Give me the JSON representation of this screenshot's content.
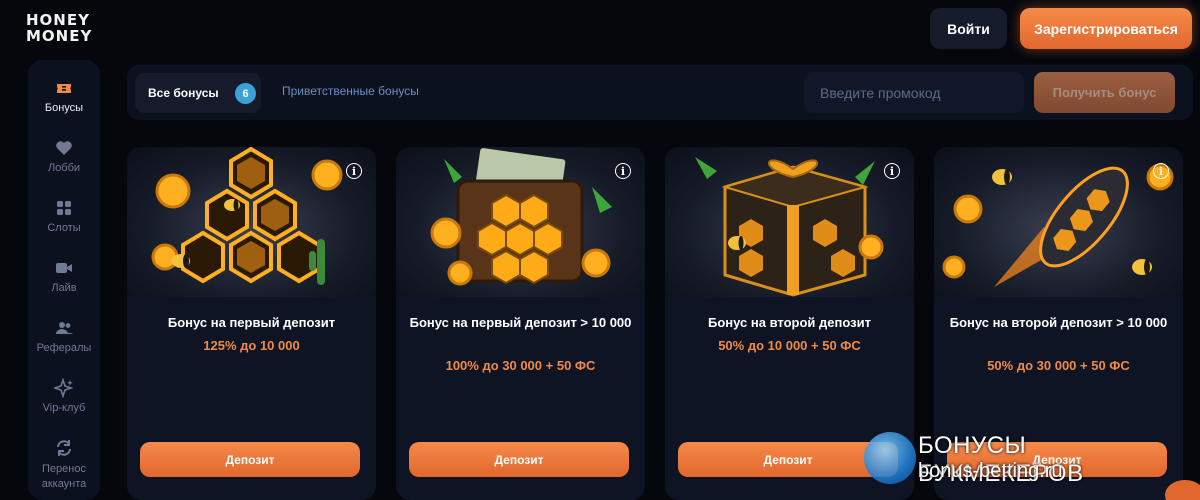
{
  "header": {
    "logo_line1": "HONEY",
    "logo_line2": "MONEY",
    "login_label": "Войти",
    "register_label": "Зарегистрироваться"
  },
  "sidebar": {
    "items": [
      {
        "label": "Бонусы",
        "icon": "ticket-icon",
        "active": true
      },
      {
        "label": "Лобби",
        "icon": "heart-icon",
        "active": false
      },
      {
        "label": "Слоты",
        "icon": "grid-icon",
        "active": false
      },
      {
        "label": "Лайв",
        "icon": "video-camera-icon",
        "active": false
      },
      {
        "label": "Рефералы",
        "icon": "users-icon",
        "active": false
      },
      {
        "label": "Vip-клуб",
        "icon": "sparkle-icon",
        "active": false
      },
      {
        "label": "Перенос аккаунта",
        "icon": "transfer-icon",
        "active": false
      }
    ]
  },
  "filters": {
    "tab_all_label": "Все бонусы",
    "tab_all_count": "6",
    "tab_welcome_label": "Приветственные бонусы",
    "promo_placeholder": "Введите промокод",
    "promo_button_label": "Получить бонус"
  },
  "cards": [
    {
      "title": "Бонус на первый депозит",
      "value": "125% до 10 000",
      "button": "Депозит",
      "art": "honeycomb"
    },
    {
      "title": "Бонус на первый депозит > 10 000",
      "value": "100% до 30 000 + 50 ФС",
      "button": "Депозит",
      "art": "wallet"
    },
    {
      "title": "Бонус на второй депозит",
      "value": "50% до 10 000 + 50 ФС",
      "button": "Депозит",
      "art": "gift"
    },
    {
      "title": "Бонус на второй депозит > 10 000",
      "value": "50% до 30 000 + 50 ФС",
      "button": "Депозит",
      "art": "rocket"
    }
  ],
  "watermark": {
    "line1": "БОНУСЫ БУКМЕКЕРОВ",
    "line2": "bonus-betting.ru"
  },
  "colors": {
    "accent": "#f08a45",
    "button_gradient_top": "#f58a49",
    "button_gradient_bottom": "#e2672d",
    "badge": "#3aa2d9",
    "background": "#05070d",
    "panel": "#0c1120"
  }
}
